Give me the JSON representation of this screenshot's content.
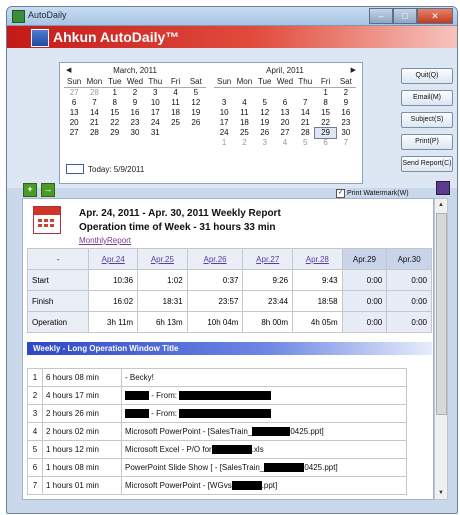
{
  "window": {
    "title": "AutoDaily",
    "controls": [
      "–",
      "□",
      "✕"
    ]
  },
  "banner": {
    "title": "Ahkun AutoDaily™"
  },
  "calendar": {
    "months": [
      {
        "name": "March, 2011",
        "headers": [
          "Sun",
          "Mon",
          "Tue",
          "Wed",
          "Thu",
          "Fri",
          "Sat"
        ],
        "days": [
          [
            "27",
            "o"
          ],
          [
            "28",
            "o"
          ],
          [
            "1",
            ""
          ],
          [
            "2",
            ""
          ],
          [
            "3",
            ""
          ],
          [
            "4",
            ""
          ],
          [
            "5",
            ""
          ],
          [
            "6",
            ""
          ],
          [
            "7",
            ""
          ],
          [
            "8",
            ""
          ],
          [
            "9",
            ""
          ],
          [
            "10",
            ""
          ],
          [
            "11",
            ""
          ],
          [
            "12",
            ""
          ],
          [
            "13",
            ""
          ],
          [
            "14",
            ""
          ],
          [
            "15",
            ""
          ],
          [
            "16",
            ""
          ],
          [
            "17",
            ""
          ],
          [
            "18",
            ""
          ],
          [
            "19",
            ""
          ],
          [
            "20",
            ""
          ],
          [
            "21",
            ""
          ],
          [
            "22",
            ""
          ],
          [
            "23",
            ""
          ],
          [
            "24",
            ""
          ],
          [
            "25",
            ""
          ],
          [
            "26",
            ""
          ],
          [
            "27",
            ""
          ],
          [
            "28",
            ""
          ],
          [
            "29",
            ""
          ],
          [
            "30",
            ""
          ],
          [
            "31",
            ""
          ],
          [
            "",
            ""
          ],
          [
            "",
            ""
          ]
        ]
      },
      {
        "name": "April, 2011",
        "headers": [
          "Sun",
          "Mon",
          "Tue",
          "Wed",
          "Thu",
          "Fri",
          "Sat"
        ],
        "days": [
          [
            "",
            ""
          ],
          [
            "",
            ""
          ],
          [
            "",
            ""
          ],
          [
            "",
            ""
          ],
          [
            "",
            ""
          ],
          [
            "1",
            ""
          ],
          [
            "2",
            ""
          ],
          [
            "3",
            ""
          ],
          [
            "4",
            ""
          ],
          [
            "5",
            ""
          ],
          [
            "6",
            ""
          ],
          [
            "7",
            ""
          ],
          [
            "8",
            ""
          ],
          [
            "9",
            ""
          ],
          [
            "10",
            ""
          ],
          [
            "11",
            ""
          ],
          [
            "12",
            ""
          ],
          [
            "13",
            ""
          ],
          [
            "14",
            ""
          ],
          [
            "15",
            ""
          ],
          [
            "16",
            ""
          ],
          [
            "17",
            ""
          ],
          [
            "18",
            ""
          ],
          [
            "19",
            ""
          ],
          [
            "20",
            ""
          ],
          [
            "21",
            ""
          ],
          [
            "22",
            ""
          ],
          [
            "23",
            ""
          ],
          [
            "24",
            ""
          ],
          [
            "25",
            ""
          ],
          [
            "26",
            ""
          ],
          [
            "27",
            ""
          ],
          [
            "28",
            ""
          ],
          [
            "29",
            "sel"
          ],
          [
            "30",
            ""
          ],
          [
            "1",
            "o"
          ],
          [
            "2",
            "o"
          ],
          [
            "3",
            "o"
          ],
          [
            "4",
            "o"
          ],
          [
            "5",
            "o"
          ],
          [
            "6",
            "o"
          ],
          [
            "7",
            "o"
          ]
        ]
      }
    ],
    "today_label": "Today: 5/9/2011"
  },
  "side_buttons": [
    "Quit(Q)",
    "Email(M)",
    "Subject(S)",
    "Print(P)",
    "Send Report(C)"
  ],
  "watermark_label": "Print Watermark(W)",
  "report": {
    "title": "Apr. 24, 2011 - Apr. 30, 2011 Weekly Report",
    "subtitle": "Operation time of Week -  31 hours 33 min",
    "link": "MonthlyReport",
    "week_table": {
      "corner": "-",
      "days": [
        "Apr.24",
        "Apr.25",
        "Apr.26",
        "Apr.27",
        "Apr.28",
        "Apr.29",
        "Apr.30"
      ],
      "rows": [
        {
          "label": "Start",
          "values": [
            "10:36",
            "1:02",
            "0:37",
            "9:26",
            "9:43",
            "0:00",
            "0:00"
          ]
        },
        {
          "label": "Finish",
          "values": [
            "16:02",
            "18:31",
            "23:57",
            "23:44",
            "18:58",
            "0:00",
            "0:00"
          ]
        },
        {
          "label": "Operation",
          "values": [
            "3h 11m",
            "6h 13m",
            "10h 04m",
            "8h 00m",
            "4h 05m",
            "0:00",
            "0:00"
          ]
        }
      ]
    },
    "section_title": "Weekly - Long Operation Window Title",
    "windows": [
      {
        "n": "1",
        "dur": "6 hours 08 min",
        "title": "- Becky!"
      },
      {
        "n": "2",
        "dur": "4 hours 17 min",
        "title": "- From:"
      },
      {
        "n": "3",
        "dur": "2 hours 26 min",
        "title": "- From:"
      },
      {
        "n": "4",
        "dur": "2 hours 02 min",
        "title": "Microsoft PowerPoint - [SalesTrain_",
        "tail": "0425.ppt]"
      },
      {
        "n": "5",
        "dur": "1 hours 12 min",
        "title": "Microsoft Excel - P/O for",
        "tail": ".xls"
      },
      {
        "n": "6",
        "dur": "1 hours 08 min",
        "title": "PowerPoint   Slide Show          [ - [SalesTrain_",
        "tail": "0425.ppt]"
      },
      {
        "n": "7",
        "dur": "1 hours 01 min",
        "title": "Microsoft PowerPoint - [WGvs",
        "tail": ".ppt]"
      }
    ]
  }
}
